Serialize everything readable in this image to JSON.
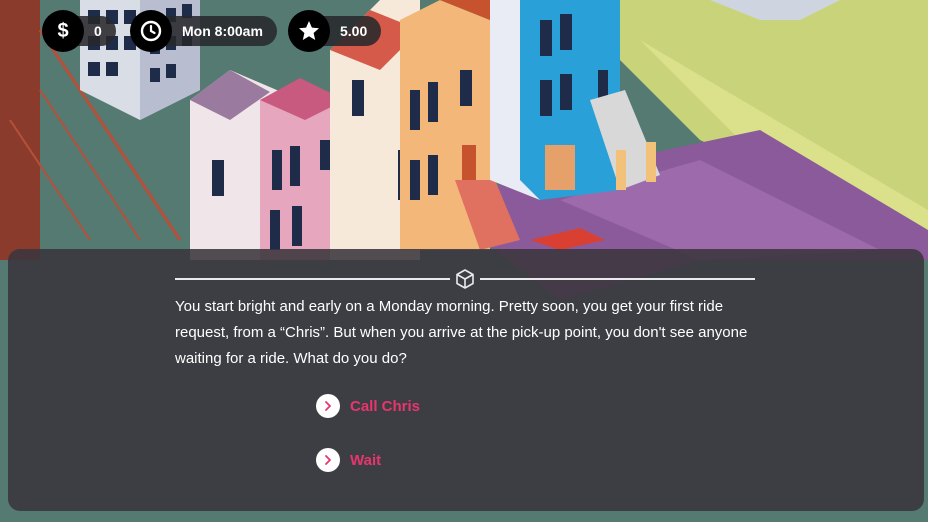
{
  "hud": {
    "money": "0",
    "time": "Mon 8:00am",
    "rating": "5.00",
    "icons": [
      "dollar-icon",
      "clock-icon",
      "star-icon"
    ]
  },
  "story": {
    "text": "You start bright and early on a Monday morning. Pretty soon, you get your first ride request, from a “Chris”. But when you arrive at the pick-up point, you don't see anyone waiting for a ride. What do you do?"
  },
  "choices": [
    {
      "label": "Call Chris"
    },
    {
      "label": "Wait"
    }
  ],
  "colors": {
    "accent": "#e8356d",
    "panel": "#3a363c",
    "hud": "#28282c"
  }
}
